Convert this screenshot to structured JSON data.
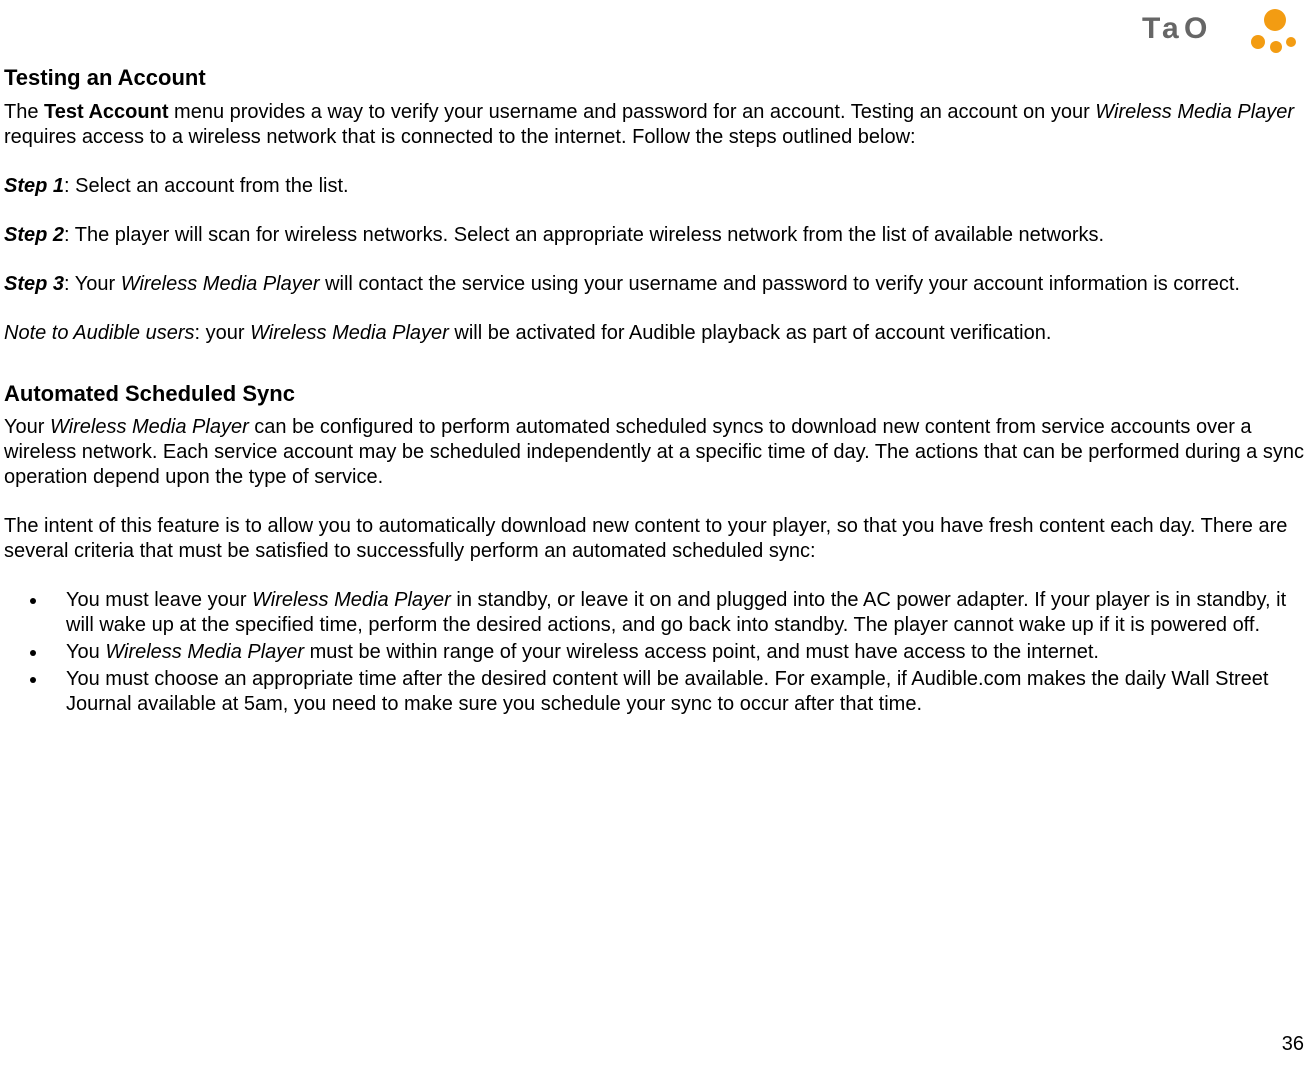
{
  "logo_text": "Tao",
  "page_number": "36",
  "section1": {
    "heading": "Testing an Account",
    "intro_pre": "The ",
    "intro_bold": "Test Account",
    "intro_mid": " menu provides a way to verify your username and password for an account.  Testing an account on your ",
    "intro_italic": "Wireless Media Player",
    "intro_post": " requires access to a wireless network that is connected to the internet.  Follow the steps outlined below:",
    "step1_label": "Step 1",
    "step1_text": ": Select an account from the list.",
    "step2_label": "Step 2",
    "step2_text": ": The player will scan for wireless networks.  Select an appropriate wireless network from the list of available networks.",
    "step3_label": "Step 3",
    "step3_pre": ": Your ",
    "step3_italic": "Wireless Media Player",
    "step3_post": " will contact the service using your username and password to verify your account information is correct.",
    "note_label": "Note to Audible users",
    "note_pre": ": your ",
    "note_italic": "Wireless Media Player",
    "note_post": " will be activated for Audible playback as part of account verification."
  },
  "section2": {
    "heading": "Automated Scheduled Sync",
    "p1_pre": "Your ",
    "p1_italic": "Wireless Media Player",
    "p1_post": " can be configured to perform automated scheduled syncs to download new content from service accounts over a wireless network.  Each service account may be scheduled independently at a specific time of day. The actions that can be performed during a sync operation depend upon the type of service.",
    "p2": "The intent of this feature is to allow you to automatically download new content to your player, so that you have fresh content each day. There are several criteria that must be satisfied to successfully perform an automated scheduled sync:",
    "bullets": {
      "b1_pre": "You must leave your ",
      "b1_italic": "Wireless Media Player",
      "b1_post": " in standby, or leave it on and plugged into the AC power adapter.  If your player is in standby, it will wake up at the specified time, perform the desired actions, and go back into standby.  The player cannot wake up if it is powered off.",
      "b2_pre": "You ",
      "b2_italic": "Wireless Media Player",
      "b2_post": " must be within range of your wireless access point, and must have access to the internet.",
      "b3": "You must choose an appropriate time after the desired content will be available. For example, if Audible.com makes the daily Wall Street Journal available at 5am, you need to make sure you schedule your sync to occur after that time."
    }
  }
}
